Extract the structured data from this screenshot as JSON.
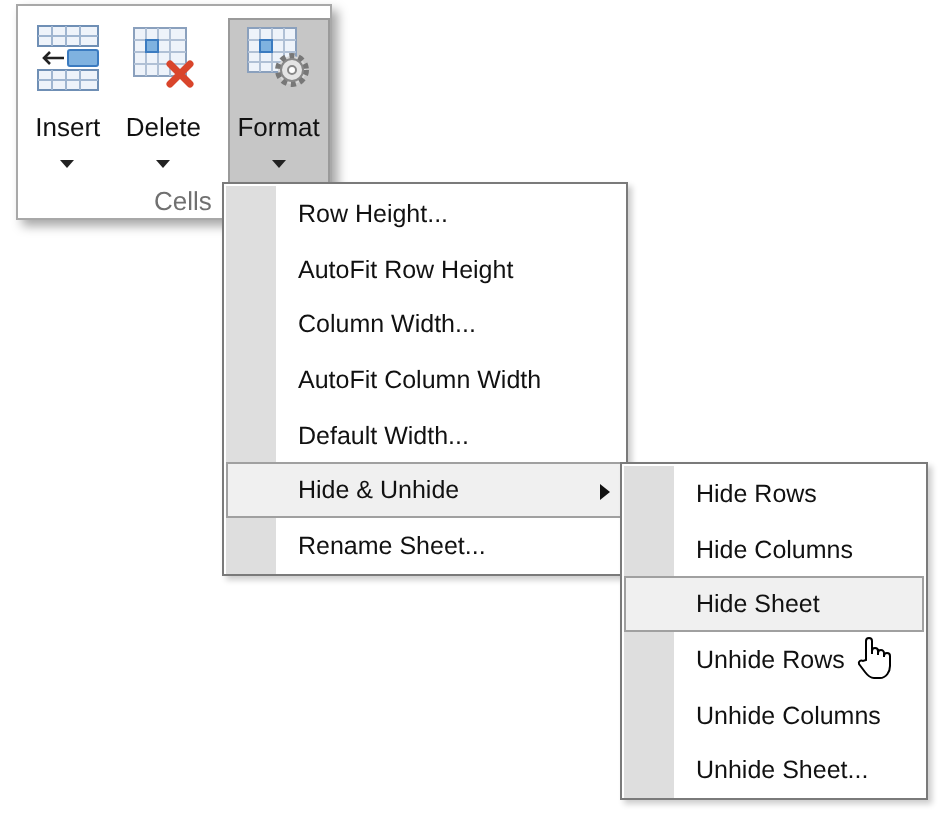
{
  "ribbon_group": {
    "label": "Cells",
    "buttons": [
      {
        "label": "Insert",
        "pressed": false
      },
      {
        "label": "Delete",
        "pressed": false
      },
      {
        "label": "Format",
        "pressed": true
      }
    ]
  },
  "menu": {
    "items": [
      {
        "label": "Row Height...",
        "has_submenu": false,
        "expanded": false
      },
      {
        "label": "AutoFit Row Height",
        "has_submenu": false,
        "expanded": false
      },
      {
        "label": "Column Width...",
        "has_submenu": false,
        "expanded": false
      },
      {
        "label": "AutoFit Column Width",
        "has_submenu": false,
        "expanded": false
      },
      {
        "label": "Default Width...",
        "has_submenu": false,
        "expanded": false
      },
      {
        "label": "Hide & Unhide",
        "has_submenu": true,
        "expanded": true
      },
      {
        "label": "Rename Sheet...",
        "has_submenu": false,
        "expanded": false
      }
    ]
  },
  "submenu": {
    "items": [
      {
        "label": "Hide Rows",
        "selected": false
      },
      {
        "label": "Hide Columns",
        "selected": false
      },
      {
        "label": "Hide Sheet",
        "selected": true
      },
      {
        "label": "Unhide Rows",
        "selected": false
      },
      {
        "label": "Unhide Columns",
        "selected": false
      },
      {
        "label": "Unhide Sheet...",
        "selected": false
      }
    ]
  }
}
